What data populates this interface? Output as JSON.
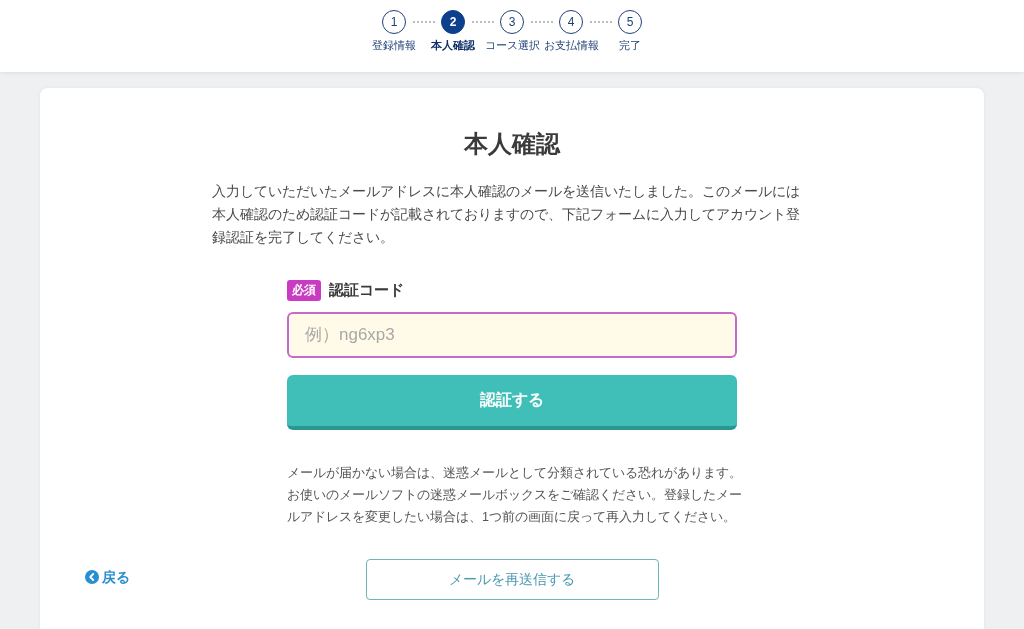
{
  "steps": [
    {
      "number": "1",
      "label": "登録情報",
      "selected": false
    },
    {
      "number": "2",
      "label": "本人確認",
      "selected": true
    },
    {
      "number": "3",
      "label": "コース選択",
      "selected": false
    },
    {
      "number": "4",
      "label": "お支払情報",
      "selected": false
    },
    {
      "number": "5",
      "label": "完了",
      "selected": false
    }
  ],
  "title": "本人確認",
  "intro": "入力していただいたメールアドレスに本人確認のメールを送信いたしました。このメールには本人確認のため認証コードが記載されておりますので、下記フォームに入力してアカウント登録認証を完了してください。",
  "form": {
    "required_badge": "必須",
    "label": "認証コード",
    "placeholder": "例）ng6xp3",
    "submit_button": "認証する"
  },
  "note": "メールが届かない場合は、迷惑メールとして分類されている恐れがあります。お使いのメールソフトの迷惑メールボックスをご確認ください。登録したメールアドレスを変更したい場合は、1つ前の画面に戻って再入力してください。",
  "back_link": "戻る",
  "resend_button": "メールを再送信する"
}
